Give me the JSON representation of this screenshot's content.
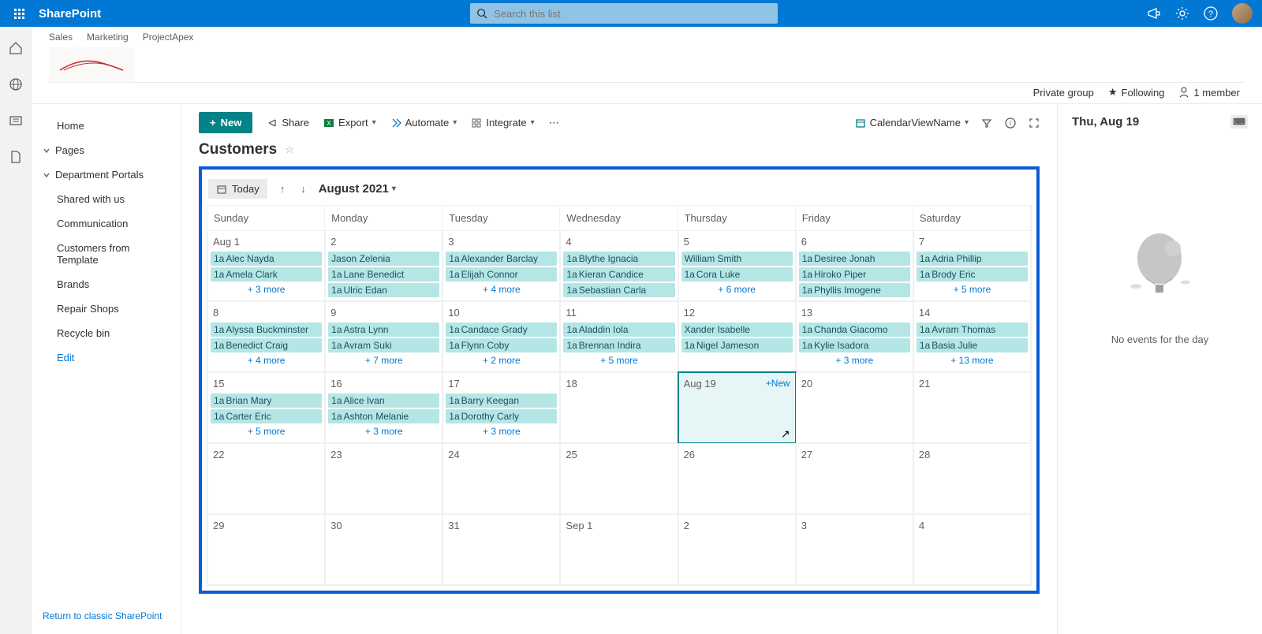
{
  "brand": "SharePoint",
  "search_placeholder": "Search this list",
  "breadcrumb": [
    "Sales",
    "Marketing",
    "ProjectApex"
  ],
  "site_meta": {
    "private": "Private group",
    "following": "Following",
    "members": "1 member"
  },
  "side_nav": {
    "items": [
      {
        "label": "Home",
        "exp": false
      },
      {
        "label": "Pages",
        "exp": true
      },
      {
        "label": "Department Portals",
        "exp": true
      },
      {
        "label": "Shared with us",
        "exp": false
      },
      {
        "label": "Communication",
        "exp": false
      },
      {
        "label": "Customers from Template",
        "exp": false
      },
      {
        "label": "Brands",
        "exp": false
      },
      {
        "label": "Repair Shops",
        "exp": false
      },
      {
        "label": "Recycle bin",
        "exp": false
      },
      {
        "label": "Edit",
        "exp": false,
        "link": true
      }
    ],
    "classic": "Return to classic SharePoint"
  },
  "toolbar": {
    "new": "New",
    "share": "Share",
    "export": "Export",
    "automate": "Automate",
    "integrate": "Integrate",
    "view_name": "CalendarViewName"
  },
  "list_title": "Customers",
  "calendar": {
    "today_btn": "Today",
    "month_label": "August 2021",
    "dow": [
      "Sunday",
      "Monday",
      "Tuesday",
      "Wednesday",
      "Thursday",
      "Friday",
      "Saturday"
    ],
    "new_label": "+New",
    "weeks": [
      [
        {
          "d": "Aug 1",
          "ev": [
            {
              "p": "1a",
              "t": "Alec Nayda"
            },
            {
              "p": "1a",
              "t": "Amela Clark"
            }
          ],
          "more": "+ 3 more"
        },
        {
          "d": "2",
          "ev": [
            {
              "p": "",
              "t": "Jason Zelenia"
            },
            {
              "p": "1a",
              "t": "Lane Benedict"
            },
            {
              "p": "1a",
              "t": "Ulric Edan"
            }
          ]
        },
        {
          "d": "3",
          "ev": [
            {
              "p": "1a",
              "t": "Alexander Barclay"
            },
            {
              "p": "1a",
              "t": "Elijah Connor"
            }
          ],
          "more": "+ 4 more"
        },
        {
          "d": "4",
          "ev": [
            {
              "p": "1a",
              "t": "Blythe Ignacia"
            },
            {
              "p": "1a",
              "t": "Kieran Candice"
            },
            {
              "p": "1a",
              "t": "Sebastian Carla"
            }
          ]
        },
        {
          "d": "5",
          "ev": [
            {
              "p": "",
              "t": "William Smith"
            },
            {
              "p": "1a",
              "t": "Cora Luke"
            }
          ],
          "more": "+ 6 more"
        },
        {
          "d": "6",
          "ev": [
            {
              "p": "1a",
              "t": "Desiree Jonah"
            },
            {
              "p": "1a",
              "t": "Hiroko Piper"
            },
            {
              "p": "1a",
              "t": "Phyllis Imogene"
            }
          ]
        },
        {
          "d": "7",
          "ev": [
            {
              "p": "1a",
              "t": "Adria Phillip"
            },
            {
              "p": "1a",
              "t": "Brody Eric"
            }
          ],
          "more": "+ 5 more"
        }
      ],
      [
        {
          "d": "8",
          "ev": [
            {
              "p": "1a",
              "t": "Alyssa Buckminster"
            },
            {
              "p": "1a",
              "t": "Benedict Craig"
            }
          ],
          "more": "+ 4 more"
        },
        {
          "d": "9",
          "ev": [
            {
              "p": "1a",
              "t": "Astra Lynn"
            },
            {
              "p": "1a",
              "t": "Avram Suki"
            }
          ],
          "more": "+ 7 more"
        },
        {
          "d": "10",
          "ev": [
            {
              "p": "1a",
              "t": "Candace Grady"
            },
            {
              "p": "1a",
              "t": "Flynn Coby"
            }
          ],
          "more": "+ 2 more"
        },
        {
          "d": "11",
          "ev": [
            {
              "p": "1a",
              "t": "Aladdin Iola"
            },
            {
              "p": "1a",
              "t": "Brennan Indira"
            }
          ],
          "more": "+ 5 more"
        },
        {
          "d": "12",
          "ev": [
            {
              "p": "",
              "t": "Xander Isabelle"
            },
            {
              "p": "1a",
              "t": "Nigel Jameson"
            }
          ]
        },
        {
          "d": "13",
          "ev": [
            {
              "p": "1a",
              "t": "Chanda Giacomo"
            },
            {
              "p": "1a",
              "t": "Kylie Isadora"
            }
          ],
          "more": "+ 3 more"
        },
        {
          "d": "14",
          "ev": [
            {
              "p": "1a",
              "t": "Avram Thomas"
            },
            {
              "p": "1a",
              "t": "Basia Julie"
            }
          ],
          "more": "+ 13 more"
        }
      ],
      [
        {
          "d": "15",
          "ev": [
            {
              "p": "1a",
              "t": "Brian Mary"
            },
            {
              "p": "1a",
              "t": "Carter Eric"
            }
          ],
          "more": "+ 5 more"
        },
        {
          "d": "16",
          "ev": [
            {
              "p": "1a",
              "t": "Alice Ivan"
            },
            {
              "p": "1a",
              "t": "Ashton Melanie"
            }
          ],
          "more": "+ 3 more"
        },
        {
          "d": "17",
          "ev": [
            {
              "p": "1a",
              "t": "Barry Keegan"
            },
            {
              "p": "1a",
              "t": "Dorothy Carly"
            }
          ],
          "more": "+ 3 more"
        },
        {
          "d": "18",
          "ev": []
        },
        {
          "d": "Aug 19",
          "ev": [],
          "today": true
        },
        {
          "d": "20",
          "ev": []
        },
        {
          "d": "21",
          "ev": []
        }
      ],
      [
        {
          "d": "22",
          "ev": []
        },
        {
          "d": "23",
          "ev": []
        },
        {
          "d": "24",
          "ev": []
        },
        {
          "d": "25",
          "ev": []
        },
        {
          "d": "26",
          "ev": []
        },
        {
          "d": "27",
          "ev": []
        },
        {
          "d": "28",
          "ev": []
        }
      ],
      [
        {
          "d": "29",
          "ev": []
        },
        {
          "d": "30",
          "ev": []
        },
        {
          "d": "31",
          "ev": []
        },
        {
          "d": "Sep 1",
          "ev": []
        },
        {
          "d": "2",
          "ev": []
        },
        {
          "d": "3",
          "ev": []
        },
        {
          "d": "4",
          "ev": []
        }
      ]
    ]
  },
  "detail": {
    "title": "Thu, Aug 19",
    "empty": "No events for the day"
  }
}
